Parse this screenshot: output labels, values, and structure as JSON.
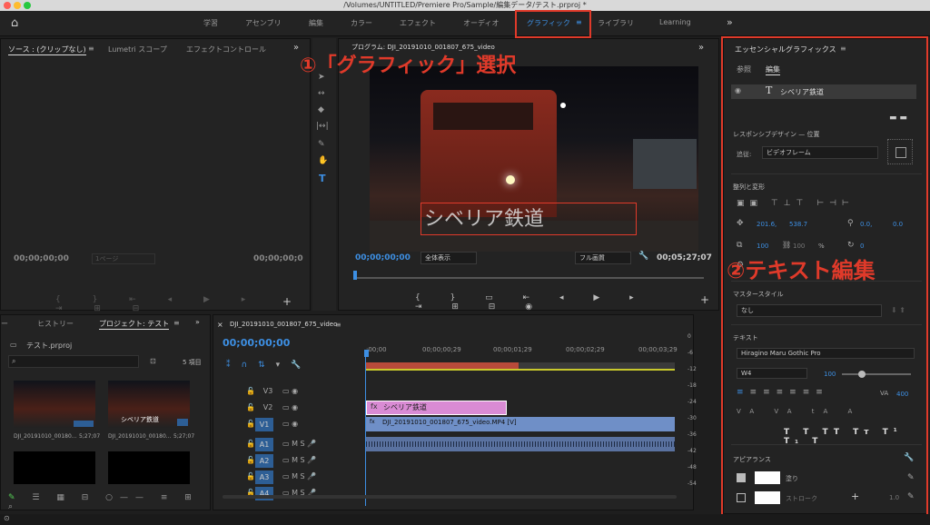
{
  "title_bar": {
    "path": "/Volumes/UNTITLED/Premiere Pro/Sample/編集データ/テスト.prproj *"
  },
  "workspaces": [
    "学習",
    "アセンブリ",
    "編集",
    "カラー",
    "エフェクト",
    "オーディオ",
    "グラフィック",
    "ライブラリ",
    "Learning"
  ],
  "active_workspace": "グラフィック",
  "source_panel": {
    "tabs": [
      "ソース : (クリップなし)",
      "Lumetri スコープ",
      "エフェクトコントロール"
    ],
    "timecode_left": "00;00;00;00",
    "page": "1ページ",
    "timecode_right": "00;00;00;0"
  },
  "program_panel": {
    "title": "プログラム: DJI_20191010_001807_675_video",
    "text_overlay": "シベリア鉄道",
    "timecode_left": "00;00;00;00",
    "zoom": "全体表示",
    "quality": "フル画質",
    "timecode_right": "00;05;27;07"
  },
  "project_panel": {
    "tabs": [
      "ー",
      "ヒストリー",
      "プロジェクト: テスト"
    ],
    "file": "テスト.prproj",
    "item_count": "5 項目",
    "clips": [
      {
        "name": "DJI_20191010_00180...",
        "duration": "5;27;07"
      },
      {
        "name": "DJI_20191010_00180...",
        "duration": "5;27;07"
      }
    ],
    "thumb_caption": "シベリア鉄道"
  },
  "timeline": {
    "sequence": "DJI_20191010_001807_675_video",
    "timecode": "00;00;00;00",
    "ruler": [
      ";00;00",
      "00;00;00;29",
      "00;00;01;29",
      "00;00;02;29",
      "00;00;03;29"
    ],
    "tracks": [
      "V3",
      "V2",
      "V1",
      "A1",
      "A2",
      "A3",
      "A4"
    ],
    "graphic_clip": "シベリア鉄道",
    "video_clip": "DJI_20191010_001807_675_video.MP4 [V]",
    "audio_scale": [
      "0",
      "-6",
      "-12",
      "-18",
      "-24",
      "-30",
      "-36",
      "-42",
      "-48",
      "-54"
    ]
  },
  "essential_graphics": {
    "title": "エッセンシャルグラフィックス",
    "tabs": [
      "参照",
      "編集"
    ],
    "layer": "シベリア鉄道",
    "responsive_title": "レスポンシブデザイン — 位置",
    "follow_label": "追従:",
    "follow_value": "ビデオフレーム",
    "align_title": "整列と変形",
    "pos_x": "201.6,",
    "pos_y": "538.7",
    "anchor_x": "0.0,",
    "anchor_y": "0.0",
    "scale": "100",
    "scale2": "100",
    "percent": "%",
    "rotation": "0",
    "master_title": "マスタースタイル",
    "master_value": "なし",
    "text_title": "テキスト",
    "font": "Hiragino Maru Gothic Pro",
    "weight": "W4",
    "size": "100",
    "tracking": "400",
    "appearance_title": "アピアランス",
    "fill": "塗り",
    "stroke": "ストローク",
    "stroke_width": "1.0"
  },
  "annotations": {
    "a1": "①「グラフィック」選択",
    "a2": "②テキスト編集"
  },
  "colors": {
    "accent": "#3d8fe3",
    "annotation": "#e03a2a",
    "graphic_clip": "#d98bd4",
    "video_clip": "#6f8fc7"
  }
}
